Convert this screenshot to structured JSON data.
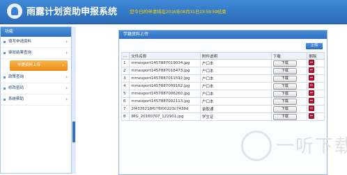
{
  "header": {
    "title": "雨露计划资助申报系统",
    "notice": "您今日的申请将在2016年08月31日23:59:59结束",
    "logo_icon": "droplet-logo-icon"
  },
  "sidebar": {
    "title": "功能",
    "items": [
      {
        "label": "填写申请资料",
        "active": false
      },
      {
        "label": "审批结果查询",
        "active": false
      },
      {
        "label": "学籍资料上传",
        "active": true
      },
      {
        "label": "政策查询",
        "active": false
      },
      {
        "label": "修改密码",
        "active": false
      },
      {
        "label": "系统帮助",
        "active": false
      }
    ]
  },
  "panel": {
    "title": "学籍资料上传",
    "upload_label": "上传",
    "columns": [
      "...",
      "文件名称",
      "附件说明",
      "下载",
      "删除"
    ],
    "rows": [
      {
        "n": "1",
        "file": "mmexport1457887019034.jpg",
        "desc": "户口本",
        "download": "下载"
      },
      {
        "n": "2",
        "file": "mmexport1457887018473.jpg",
        "desc": "户口本",
        "download": "下载"
      },
      {
        "n": "3",
        "file": "mmexport1457887011592.jpg",
        "desc": "户口本",
        "download": "下载"
      },
      {
        "n": "4",
        "file": "mmexport1457887009162.jpg",
        "desc": "户口本",
        "download": "下载"
      },
      {
        "n": "5",
        "file": "mmexport1457887006260.jpg",
        "desc": "户口本",
        "download": "下载"
      },
      {
        "n": "6",
        "file": "mmexport1457887002113.jpg",
        "desc": "户口本",
        "download": "下载"
      },
      {
        "n": "7",
        "file": "2f4335218f078f00223c7438d",
        "desc": "录取通",
        "download": "下载"
      },
      {
        "n": "8",
        "file": "IMG_20160707_122901.jpg",
        "desc": "学生证",
        "download": "下载"
      }
    ]
  },
  "watermark": {
    "text": "一听下载"
  }
}
